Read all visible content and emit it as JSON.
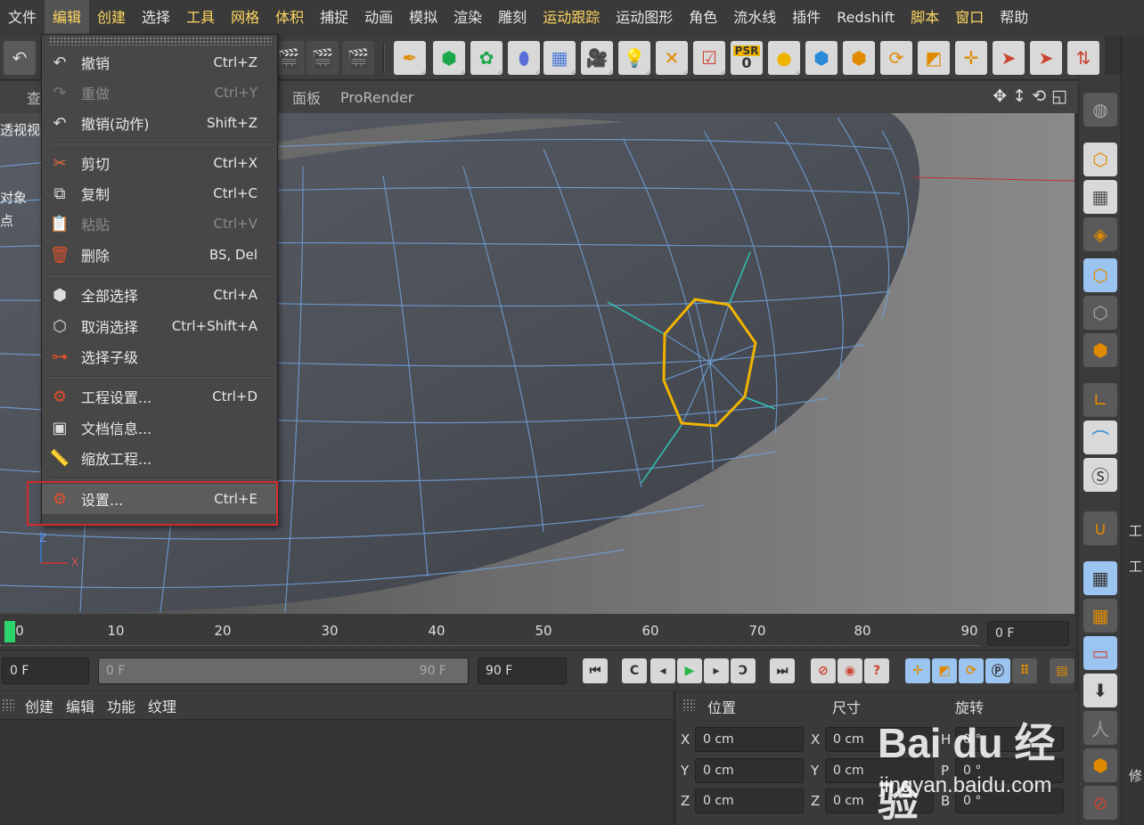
{
  "menubar": {
    "items": [
      "文件",
      "编辑",
      "创建",
      "选择",
      "工具",
      "网格",
      "体积",
      "捕捉",
      "动画",
      "模拟",
      "渲染",
      "雕刻",
      "运动跟踪",
      "运动图形",
      "角色",
      "流水线",
      "插件",
      "Redshift",
      "脚本",
      "窗口",
      "帮助"
    ]
  },
  "viewport": {
    "tabs": [
      "查",
      "面板",
      "ProRender"
    ],
    "left_labels": [
      "透视视",
      "对象",
      "点"
    ],
    "axis_z": "Z",
    "axis_x": "X"
  },
  "dropdown": {
    "items": [
      {
        "label": "撤销",
        "shortcut": "Ctrl+Z",
        "icon": "undo-icon"
      },
      {
        "label": "重做",
        "shortcut": "Ctrl+Y",
        "icon": "redo-icon"
      },
      {
        "label": "撤销(动作)",
        "shortcut": "Shift+Z",
        "icon": "undo-action-icon"
      },
      {
        "label": "剪切",
        "shortcut": "Ctrl+X",
        "icon": "scissors-icon"
      },
      {
        "label": "复制",
        "shortcut": "Ctrl+C",
        "icon": "copy-icon"
      },
      {
        "label": "粘贴",
        "shortcut": "Ctrl+V",
        "icon": "paste-icon"
      },
      {
        "label": "删除",
        "shortcut": "BS, Del",
        "icon": "trash-icon"
      },
      {
        "label": "全部选择",
        "shortcut": "Ctrl+A",
        "icon": "select-all-icon"
      },
      {
        "label": "取消选择",
        "shortcut": "Ctrl+Shift+A",
        "icon": "deselect-icon"
      },
      {
        "label": "选择子级",
        "shortcut": "",
        "icon": "select-children-icon"
      },
      {
        "label": "工程设置...",
        "shortcut": "Ctrl+D",
        "icon": "project-settings-icon"
      },
      {
        "label": "文档信息...",
        "shortcut": "",
        "icon": "document-info-icon"
      },
      {
        "label": "缩放工程...",
        "shortcut": "",
        "icon": "scale-project-icon"
      },
      {
        "label": "设置...",
        "shortcut": "Ctrl+E",
        "icon": "preferences-icon"
      }
    ]
  },
  "toolbar": {
    "psr_label": "PSR",
    "psr_value": "0"
  },
  "timeline": {
    "ticks": [
      "0",
      "10",
      "20",
      "30",
      "40",
      "50",
      "60",
      "70",
      "80",
      "90"
    ],
    "frame_field": "0 F"
  },
  "transport": {
    "start_field": "0 F",
    "range_start": "0 F",
    "range_end": "90 F",
    "end_field": "90 F"
  },
  "material_panel": {
    "menu": [
      "创建",
      "编辑",
      "功能",
      "纹理"
    ]
  },
  "coordinates": {
    "headers": [
      "位置",
      "尺寸",
      "旋转"
    ],
    "rows": [
      {
        "axis": "X",
        "pos": "0 cm",
        "size_axis": "X",
        "size": "0 cm",
        "rot_axis": "H",
        "rot": "0 °"
      },
      {
        "axis": "Y",
        "pos": "0 cm",
        "size_axis": "Y",
        "size": "0 cm",
        "rot_axis": "P",
        "rot": "0 °"
      },
      {
        "axis": "Z",
        "pos": "0 cm",
        "size_axis": "Z",
        "size": "0 cm",
        "rot_axis": "B",
        "rot": "0 °"
      }
    ]
  },
  "right_panel": {
    "labels": [
      "工",
      "工",
      "修"
    ]
  },
  "watermark": {
    "logo": "Bai du 经验",
    "url": "jingyan.baidu.com"
  },
  "colors": {
    "accent_green": "#2bd56b",
    "selection_yellow": "#f0b400",
    "highlight_red": "#d42a2a",
    "mesh_blue": "#6ea0d8",
    "menu_highlight": "#ffd760"
  }
}
